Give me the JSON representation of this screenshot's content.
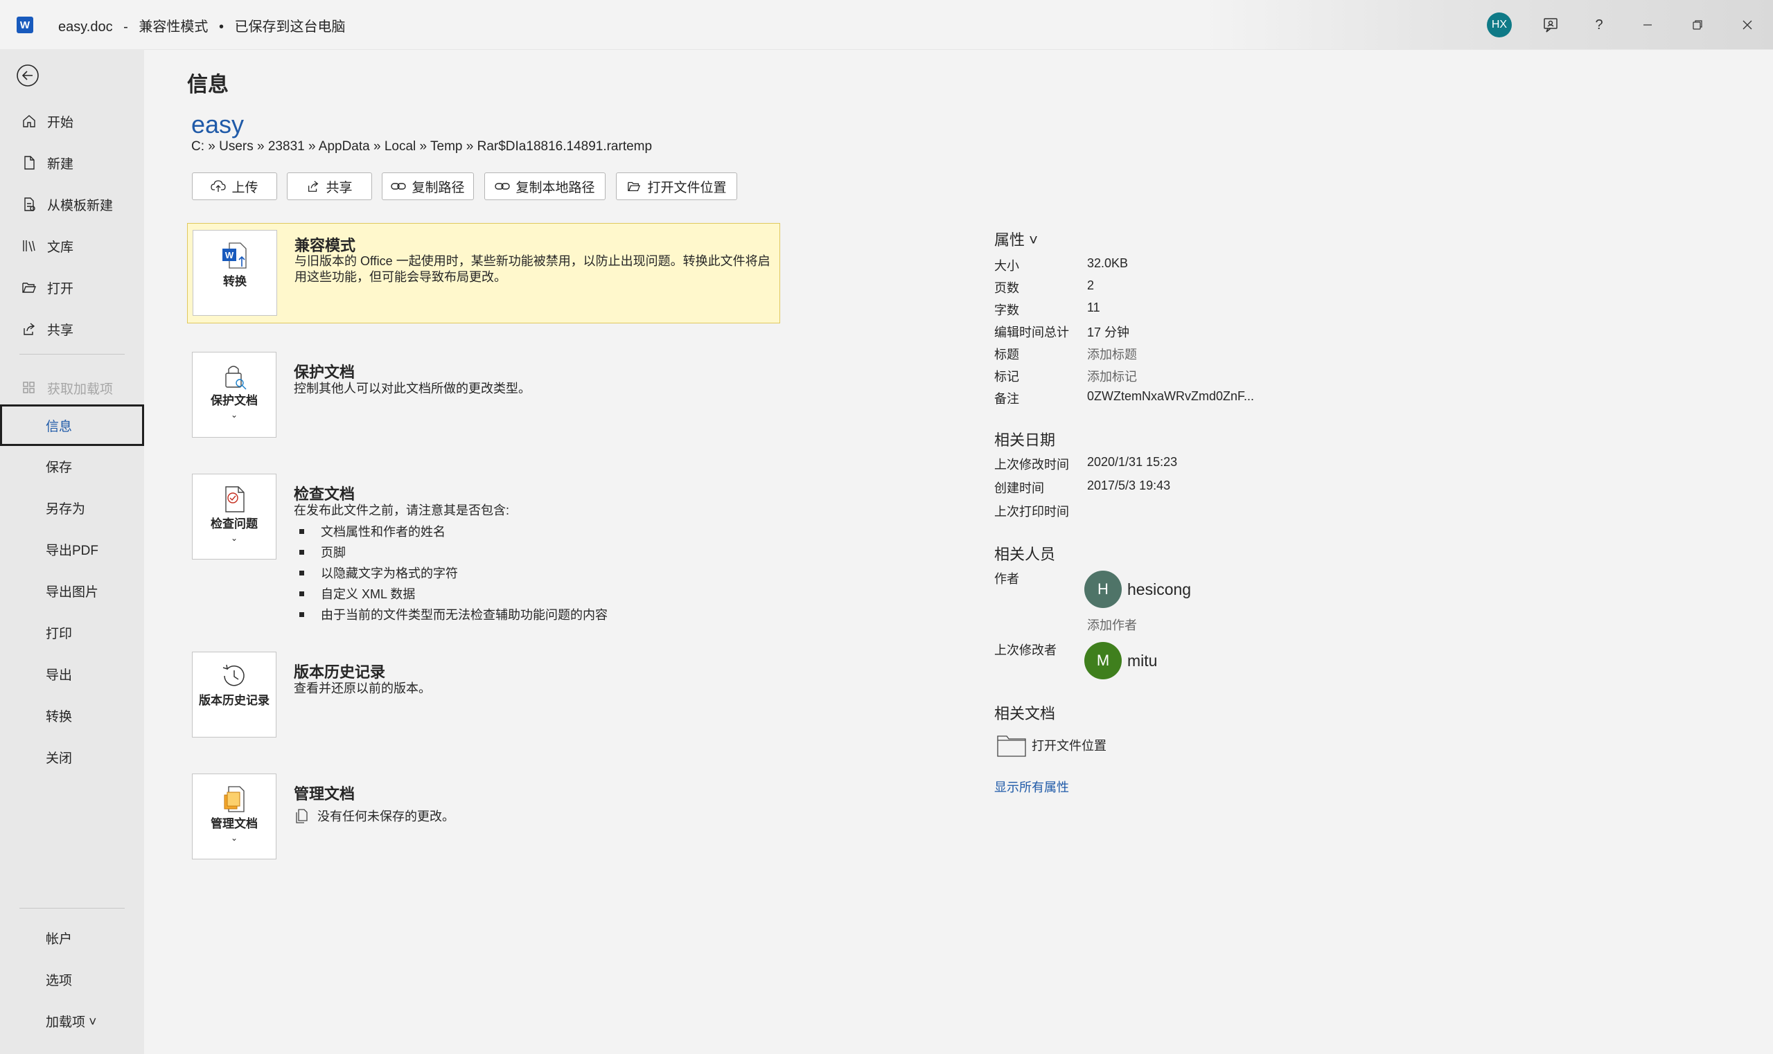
{
  "titlebar": {
    "app_icon": "word-icon",
    "filename": "easy.doc",
    "separator": "-",
    "mode": "兼容性模式",
    "dot": "•",
    "save_status": "已保存到这台电脑",
    "avatar_initials": "HX",
    "avatar_color": "#0f7a87"
  },
  "sidebar": {
    "items": [
      {
        "label": "开始",
        "icon": "home-icon"
      },
      {
        "label": "新建",
        "icon": "new-file-icon"
      },
      {
        "label": "从模板新建",
        "icon": "template-icon"
      },
      {
        "label": "文库",
        "icon": "library-icon"
      },
      {
        "label": "打开",
        "icon": "folder-open-icon"
      },
      {
        "label": "共享",
        "icon": "share-icon"
      },
      {
        "label": "获取加载项",
        "icon": "addins-icon"
      },
      {
        "label": "信息"
      },
      {
        "label": "保存"
      },
      {
        "label": "另存为"
      },
      {
        "label": "导出PDF"
      },
      {
        "label": "导出图片"
      },
      {
        "label": "打印"
      },
      {
        "label": "导出"
      },
      {
        "label": "转换"
      },
      {
        "label": "关闭"
      }
    ],
    "bottom": [
      {
        "label": "帐户"
      },
      {
        "label": "选项"
      },
      {
        "label": "加载项 ˅"
      }
    ]
  },
  "main": {
    "page_title": "信息",
    "doc_name": "easy",
    "doc_path": "C: » Users » 23831 » AppData » Local » Temp » Rar$DIa18816.14891.rartemp",
    "actions": [
      {
        "label": "上传",
        "icon": "upload-icon"
      },
      {
        "label": "共享",
        "icon": "share-icon"
      },
      {
        "label": "复制路径",
        "icon": "link-icon"
      },
      {
        "label": "复制本地路径",
        "icon": "link-icon"
      },
      {
        "label": "打开文件位置",
        "icon": "folder-open-icon"
      }
    ],
    "cards": {
      "compat": {
        "tile": "转换",
        "title": "兼容模式",
        "desc": "与旧版本的 Office 一起使用时，某些新功能被禁用，以防止出现问题。转换此文件将启用这些功能，但可能会导致布局更改。"
      },
      "protect": {
        "tile": "保护文档",
        "title": "保护文档",
        "desc": "控制其他人可以对此文档所做的更改类型。"
      },
      "inspect": {
        "tile": "检查问题",
        "title": "检查文档",
        "desc": "在发布此文件之前，请注意其是否包含:",
        "bullets": [
          "文档属性和作者的姓名",
          "页脚",
          "以隐藏文字为格式的字符",
          "自定义 XML 数据",
          "由于当前的文件类型而无法检查辅助功能问题的内容"
        ]
      },
      "history": {
        "tile": "版本历史记录",
        "title": "版本历史记录",
        "desc": "查看并还原以前的版本。"
      },
      "manage": {
        "tile": "管理文档",
        "title": "管理文档",
        "desc": "没有任何未保存的更改。"
      }
    }
  },
  "properties": {
    "title": "属性 ˅",
    "rows": [
      {
        "k": "大小",
        "v": "32.0KB"
      },
      {
        "k": "页数",
        "v": "2"
      },
      {
        "k": "字数",
        "v": "11"
      },
      {
        "k": "编辑时间总计",
        "v": "17 分钟"
      },
      {
        "k": "标题",
        "v": "添加标题"
      },
      {
        "k": "标记",
        "v": "添加标记"
      },
      {
        "k": "备注",
        "v": "0ZWZtemNxaWRvZmd0ZnF..."
      }
    ],
    "dates_title": "相关日期",
    "dates": [
      {
        "k": "上次修改时间",
        "v": "2020/1/31 15:23"
      },
      {
        "k": "创建时间",
        "v": "2017/5/3 19:43"
      },
      {
        "k": "上次打印时间",
        "v": ""
      }
    ],
    "people_title": "相关人员",
    "author_label": "作者",
    "author": {
      "initial": "H",
      "name": "hesicong",
      "color": "#4f7468"
    },
    "add_author": "添加作者",
    "last_modifier_label": "上次修改者",
    "last_modifier": {
      "initial": "M",
      "name": "mitu",
      "color": "#3f7f1d"
    },
    "docs_title": "相关文档",
    "open_location": "打开文件位置",
    "show_all": "显示所有属性"
  }
}
